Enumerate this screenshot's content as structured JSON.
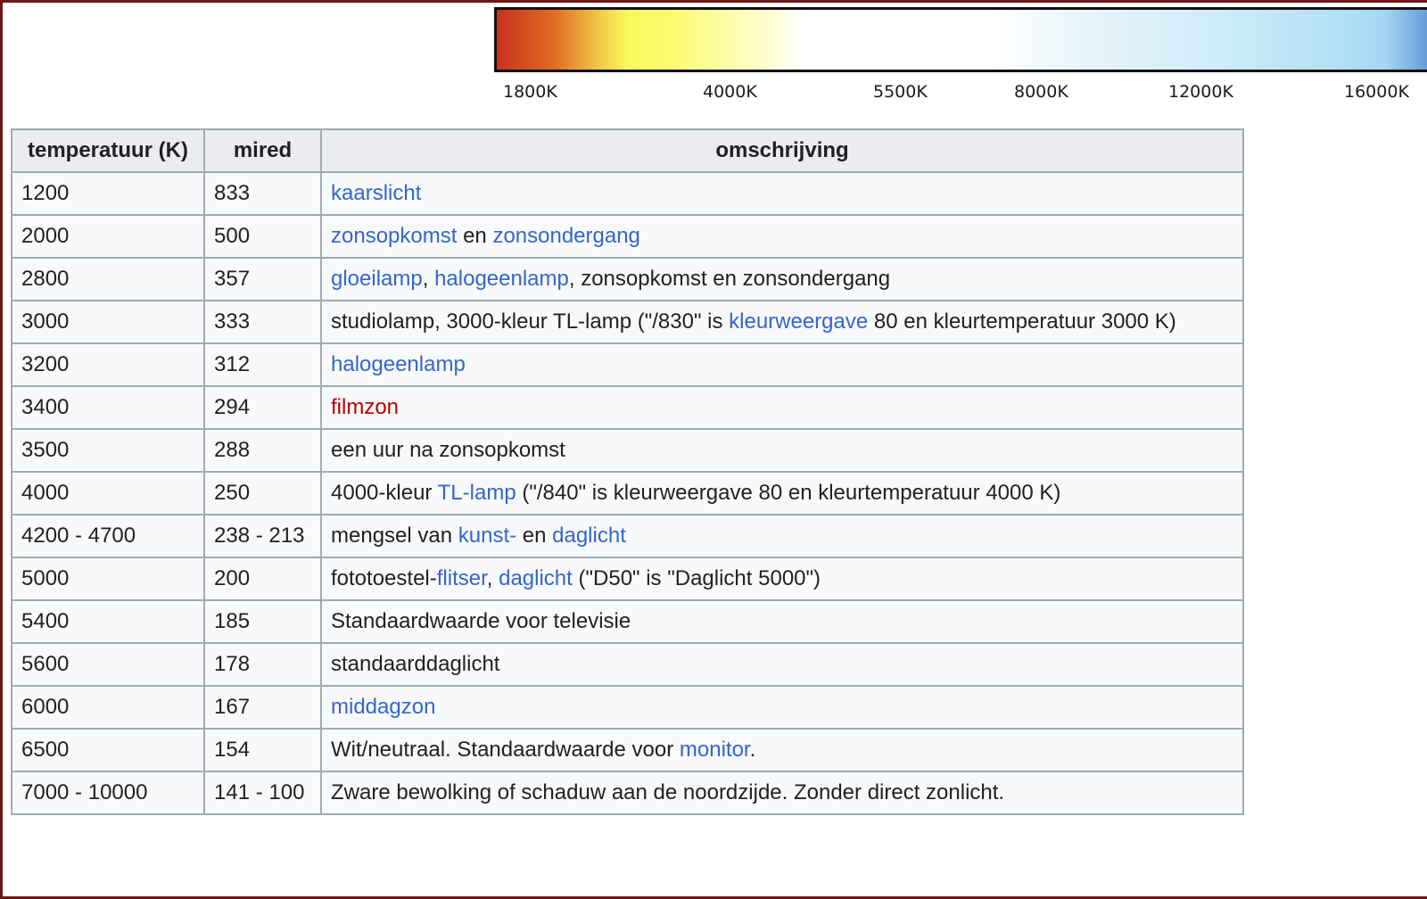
{
  "scale": {
    "labels": [
      "1800K",
      "4000K",
      "5500K",
      "8000K",
      "12000K",
      "16000K"
    ],
    "colors": {
      "warm": "#c8321e",
      "yellow": "#fbf85a",
      "neutral": "#ffffff",
      "cool": "#5f95d7"
    }
  },
  "table": {
    "headers": {
      "temp": "temperatuur (K)",
      "mired": "mired",
      "desc": "omschrijving"
    },
    "rows": [
      {
        "temp": "1200",
        "mired": "833",
        "desc": [
          {
            "t": "kaarslicht",
            "k": "link"
          }
        ]
      },
      {
        "temp": "2000",
        "mired": "500",
        "desc": [
          {
            "t": "zonsopkomst",
            "k": "link"
          },
          {
            "t": " en "
          },
          {
            "t": "zonsondergang",
            "k": "link"
          }
        ]
      },
      {
        "temp": "2800",
        "mired": "357",
        "desc": [
          {
            "t": "gloeilamp",
            "k": "link"
          },
          {
            "t": ", "
          },
          {
            "t": "halogeenlamp",
            "k": "link"
          },
          {
            "t": ", zonsopkomst en zonsondergang"
          }
        ]
      },
      {
        "temp": "3000",
        "mired": "333",
        "desc": [
          {
            "t": "studiolamp, 3000-kleur TL-lamp (\"/830\" is "
          },
          {
            "t": "kleurweergave",
            "k": "link"
          },
          {
            "t": " 80 en kleurtemperatuur 3000 K)"
          }
        ]
      },
      {
        "temp": "3200",
        "mired": "312",
        "desc": [
          {
            "t": "halogeenlamp",
            "k": "link"
          }
        ]
      },
      {
        "temp": "3400",
        "mired": "294",
        "desc": [
          {
            "t": "filmzon",
            "k": "redlink"
          }
        ]
      },
      {
        "temp": "3500",
        "mired": "288",
        "desc": [
          {
            "t": "een uur na zonsopkomst"
          }
        ]
      },
      {
        "temp": "4000",
        "mired": "250",
        "desc": [
          {
            "t": "4000-kleur "
          },
          {
            "t": "TL-lamp",
            "k": "link"
          },
          {
            "t": " (\"/840\" is kleurweergave 80 en kleurtemperatuur 4000 K)"
          }
        ]
      },
      {
        "temp": "4200 - 4700",
        "mired": "238 - 213",
        "desc": [
          {
            "t": "mengsel van "
          },
          {
            "t": "kunst-",
            "k": "link"
          },
          {
            "t": " en "
          },
          {
            "t": "daglicht",
            "k": "link"
          }
        ]
      },
      {
        "temp": "5000",
        "mired": "200",
        "desc": [
          {
            "t": "fototoestel-"
          },
          {
            "t": "flitser",
            "k": "link"
          },
          {
            "t": ", "
          },
          {
            "t": "daglicht",
            "k": "link"
          },
          {
            "t": " (\"D50\" is \"Daglicht 5000\")"
          }
        ]
      },
      {
        "temp": "5400",
        "mired": "185",
        "desc": [
          {
            "t": "Standaardwaarde voor televisie"
          }
        ]
      },
      {
        "temp": "5600",
        "mired": "178",
        "desc": [
          {
            "t": "standaarddaglicht"
          }
        ]
      },
      {
        "temp": "6000",
        "mired": "167",
        "desc": [
          {
            "t": "middagzon",
            "k": "link"
          }
        ]
      },
      {
        "temp": "6500",
        "mired": "154",
        "desc": [
          {
            "t": "Wit/neutraal. Standaardwaarde voor "
          },
          {
            "t": "monitor",
            "k": "link"
          },
          {
            "t": "."
          }
        ]
      },
      {
        "temp": "7000 - 10000",
        "mired": "141 - 100",
        "desc": [
          {
            "t": "Zware bewolking of schaduw aan de noordzijde. Zonder direct zonlicht."
          }
        ]
      }
    ]
  }
}
